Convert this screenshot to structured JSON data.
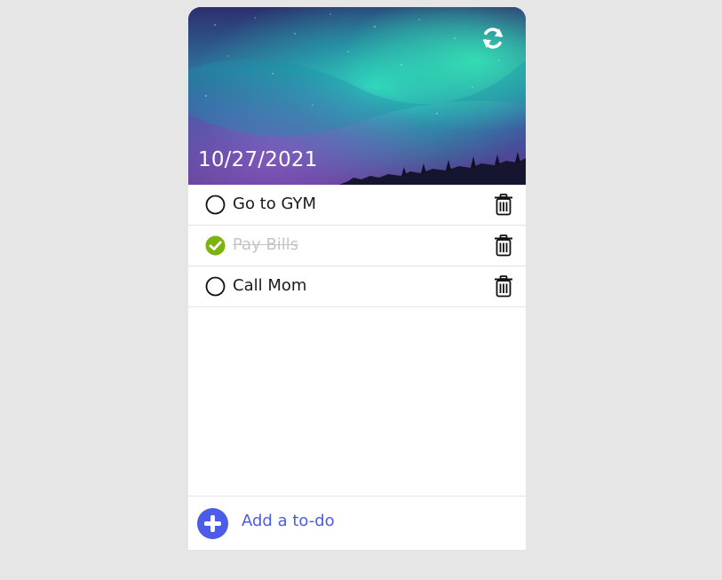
{
  "header": {
    "date": "10/27/2021",
    "refresh_icon": "refresh-icon"
  },
  "todos": [
    {
      "text": "Go to GYM",
      "done": false
    },
    {
      "text": "Pay Bills",
      "done": true
    },
    {
      "text": "Call Mom",
      "done": false
    }
  ],
  "footer": {
    "add_label": "Add a to-do"
  },
  "colors": {
    "page_background": "#e6e6e6",
    "accent": "#4a5ce8",
    "done_check": "#7cb30f",
    "done_text": "#c4c4c4"
  }
}
